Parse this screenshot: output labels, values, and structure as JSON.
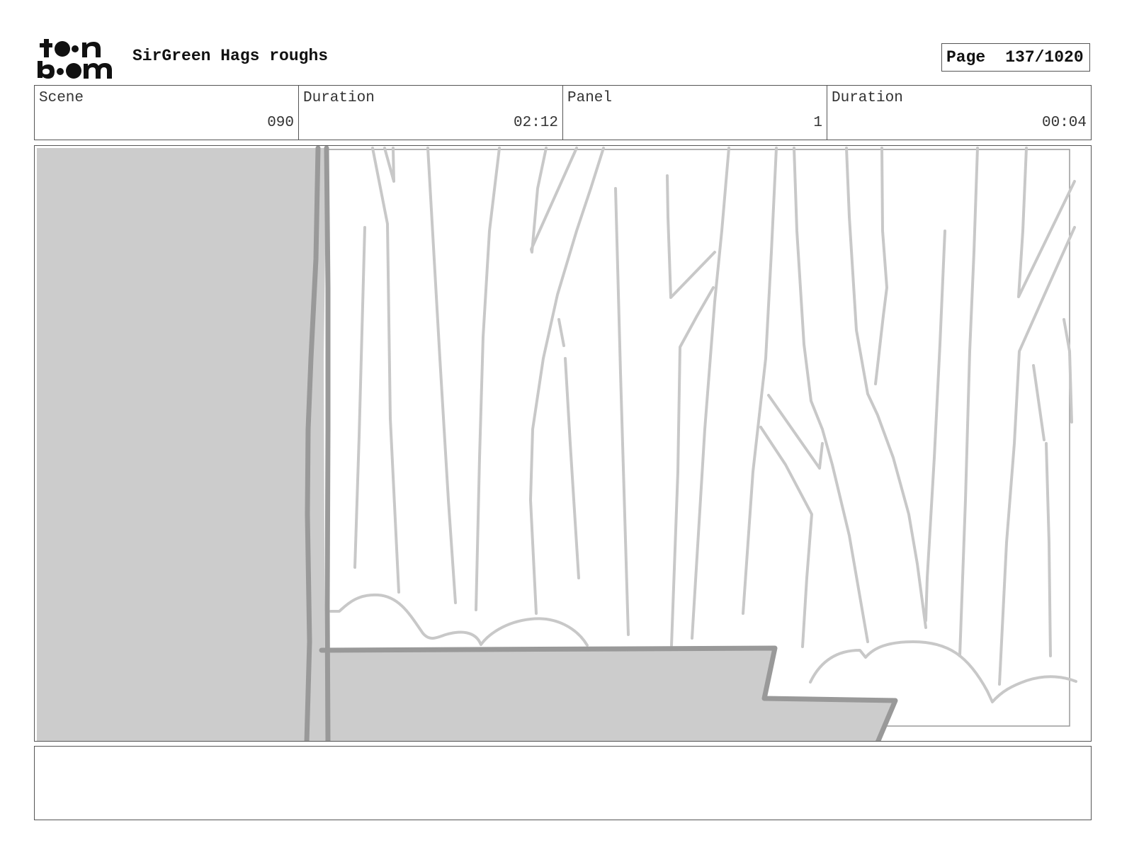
{
  "header": {
    "logo_alt": "toon boom",
    "project_title": "SirGreen Hags roughs",
    "page_label": "Page",
    "page_number": "137/1020"
  },
  "info": {
    "scene_label": "Scene",
    "scene_value": "090",
    "scene_duration_label": "Duration",
    "scene_duration_value": "02:12",
    "panel_label": "Panel",
    "panel_value": "1",
    "panel_duration_label": "Duration",
    "panel_duration_value": "00:04"
  },
  "notes": {
    "text": ""
  }
}
